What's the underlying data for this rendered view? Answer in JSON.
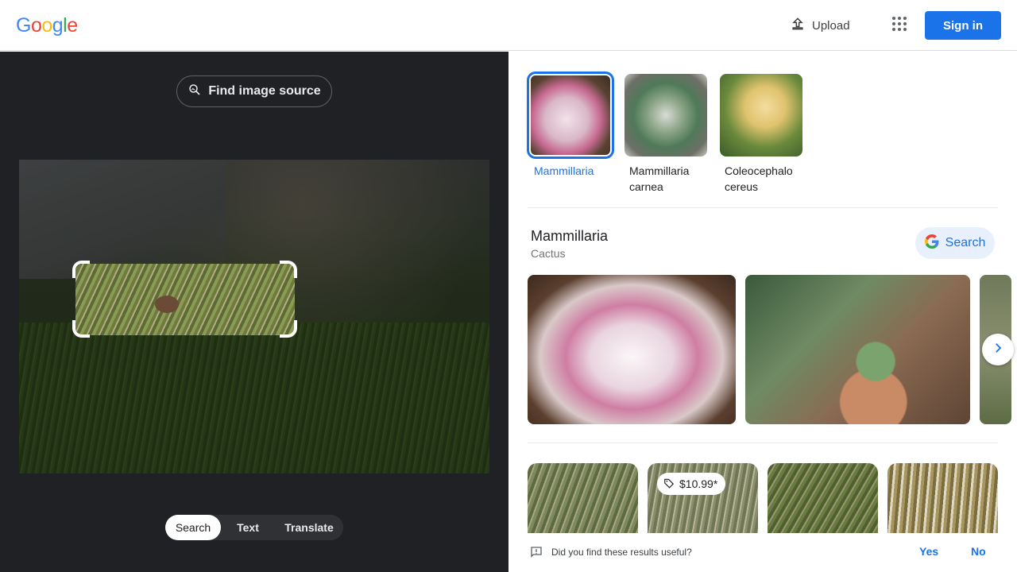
{
  "header": {
    "logo_letters": [
      {
        "char": "G",
        "color": "#4285F4"
      },
      {
        "char": "o",
        "color": "#EA4335"
      },
      {
        "char": "o",
        "color": "#FBBC05"
      },
      {
        "char": "g",
        "color": "#4285F4"
      },
      {
        "char": "l",
        "color": "#34A853"
      },
      {
        "char": "e",
        "color": "#EA4335"
      }
    ],
    "upload_label": "Upload",
    "upload_icon": "upload-icon",
    "apps_icon": "apps-grid-icon",
    "signin_label": "Sign in"
  },
  "left": {
    "find_source_label": "Find image source",
    "find_source_icon": "image-search-icon",
    "mode_tabs": [
      {
        "label": "Search",
        "active": true
      },
      {
        "label": "Text",
        "active": false
      },
      {
        "label": "Translate",
        "active": false
      }
    ]
  },
  "right": {
    "chips": [
      {
        "label": "Mammillaria",
        "active": true
      },
      {
        "label": "Mammillaria carnea",
        "active": false
      },
      {
        "label": "Coleocephalo cereus",
        "active": false
      }
    ],
    "knowledge": {
      "title": "Mammillaria",
      "subtitle": "Cactus",
      "search_label": "Search"
    },
    "results": [
      {
        "price": ""
      },
      {
        "price": "$10.99*"
      },
      {
        "price": ""
      },
      {
        "price": ""
      }
    ],
    "feedback": {
      "question": "Did you find these results useful?",
      "yes": "Yes",
      "no": "No"
    }
  },
  "colors": {
    "accent": "#1a73e8",
    "dark_panel": "#202124"
  }
}
